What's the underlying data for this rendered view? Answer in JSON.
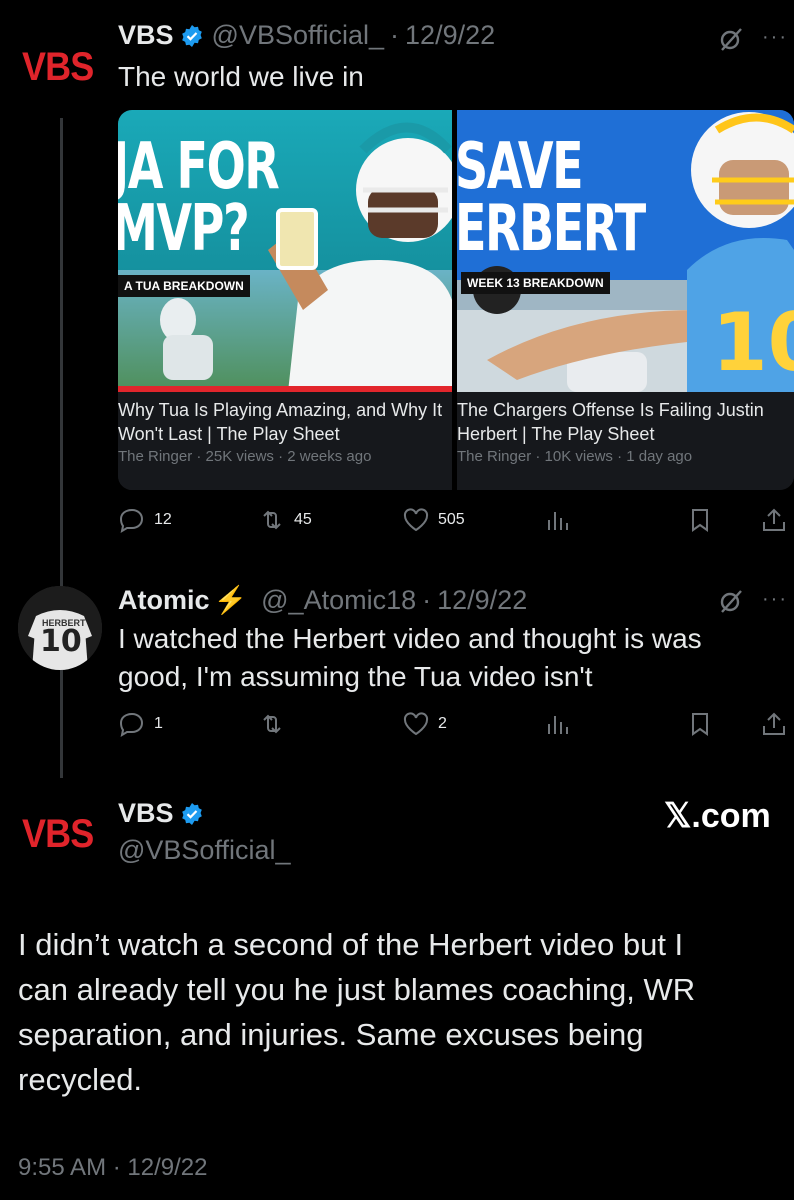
{
  "tweet1": {
    "avatar_text": "VBS",
    "name": "VBS",
    "handle": "@VBSofficial_",
    "date": "12/9/22",
    "text": "The world we live in",
    "videos": [
      {
        "thumb_title": "JA FOR\nMVP?",
        "thumb_tag": "A TUA BREAKDOWN",
        "title_line1": "Why Tua Is Playing Amazing, and Why It",
        "title_line2": "Won't Last | The Play Sheet",
        "meta": "The Ringer · 25K views · 2 weeks ago"
      },
      {
        "thumb_title": "SAVE\nERBERT",
        "thumb_tag": "WEEK 13 BREAKDOWN",
        "title_line1": "The Chargers Offense Is Failing Justin",
        "title_line2": "Herbert | The Play Sheet",
        "meta": "The Ringer · 10K views · 1 day ago"
      }
    ],
    "replies": "12",
    "reposts": "45",
    "likes": "505"
  },
  "tweet2": {
    "name": "Atomic",
    "emoji": "⚡",
    "handle": "@_Atomic18",
    "date": "12/9/22",
    "text_line1": "I watched the Herbert video and thought is was",
    "text_line2": "good, I'm assuming the Tua video isn't",
    "replies": "1",
    "likes": "2",
    "avatar_jersey": "10",
    "avatar_name": "HERBERT"
  },
  "tweet3": {
    "avatar_text": "VBS",
    "name": "VBS",
    "handle": "@VBSofficial_",
    "source": "𝕏.com",
    "text_line1": "I didn’t watch a second of the Herbert video but I",
    "text_line2": "can already tell you he just blames coaching, WR",
    "text_line3": "separation, and injuries. Same excuses being",
    "text_line4": "recycled.",
    "time": "9:55 AM",
    "date": "12/9/22"
  },
  "icons": {
    "more": "more-icon",
    "grok": "grok-icon",
    "reply": "reply-icon",
    "repost": "repost-icon",
    "like": "heart-icon",
    "views": "views-icon",
    "bookmark": "bookmark-icon",
    "share": "share-icon",
    "verified": "verified-badge-icon"
  },
  "colors": {
    "background": "#000000",
    "text": "#e7e9ea",
    "secondary": "#71767b",
    "verified": "#1d9bf0",
    "brand_red": "#e0242b"
  }
}
